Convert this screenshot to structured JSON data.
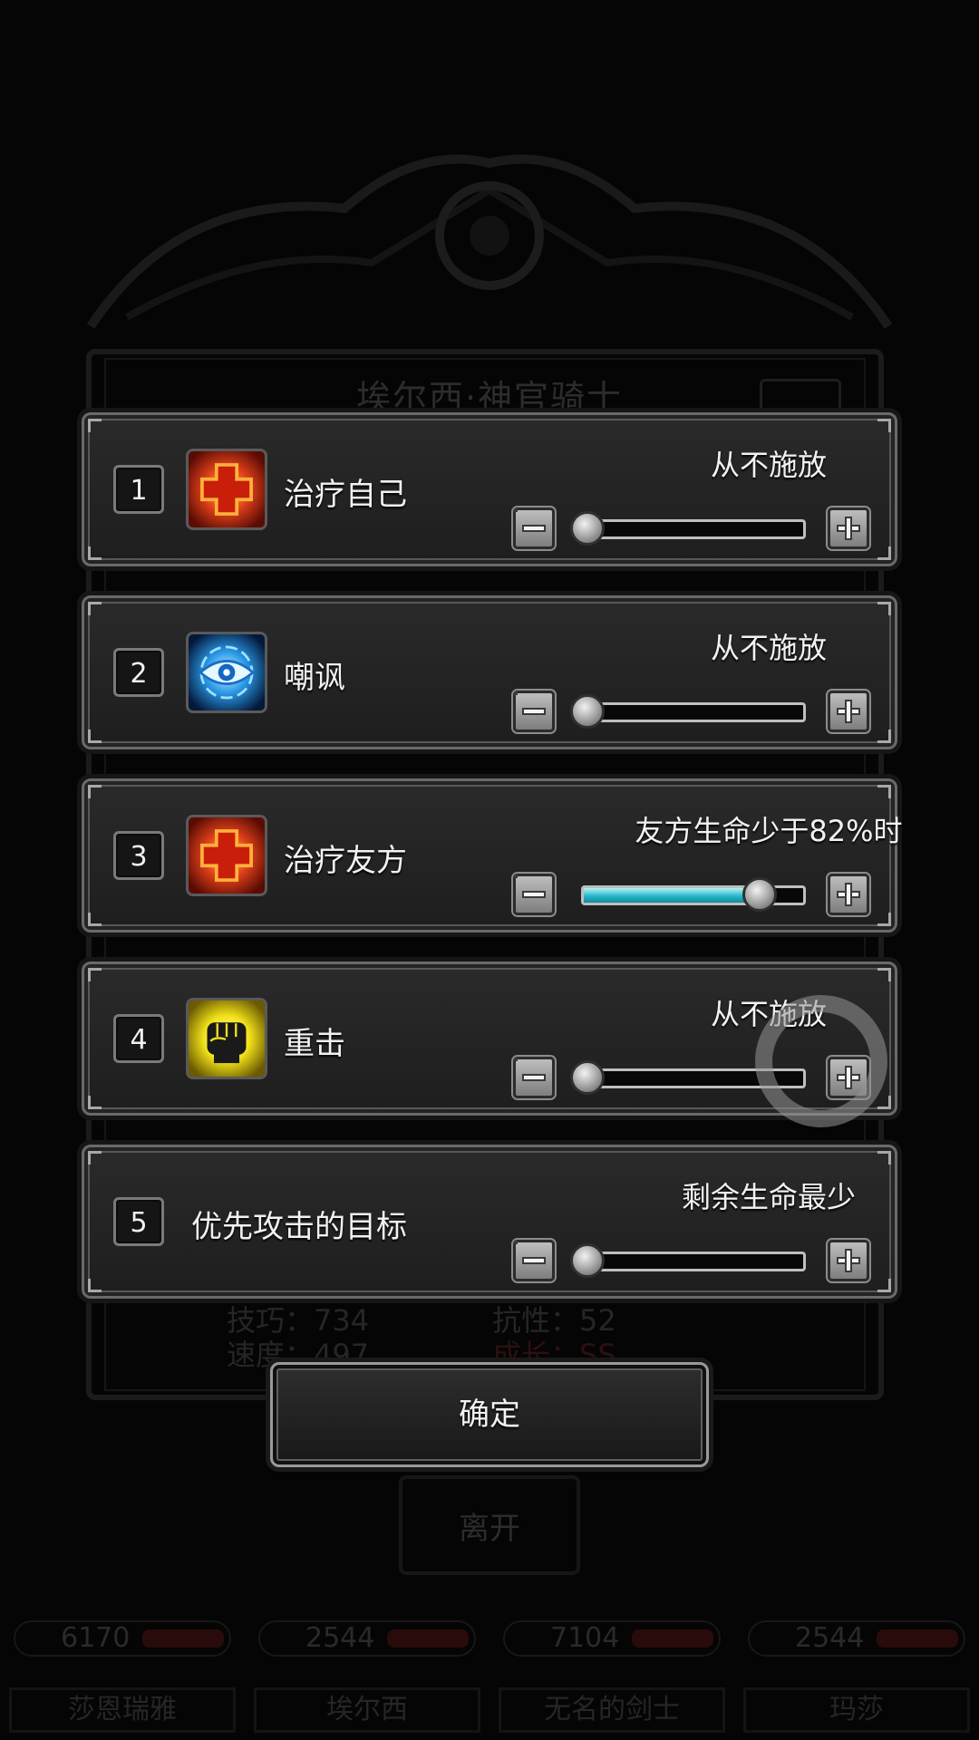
{
  "background": {
    "hero_title": "埃尔西·神官骑士",
    "stats": [
      {
        "label": "技巧：734"
      },
      {
        "label": "抗性：52"
      },
      {
        "label": "速度：497"
      },
      {
        "label": "成长：SS"
      }
    ],
    "leave_button": "离开",
    "party": [
      {
        "hp": "6170",
        "name": "莎恩瑞雅"
      },
      {
        "hp": "2544",
        "name": "埃尔西"
      },
      {
        "hp": "7104",
        "name": "无名的剑士"
      },
      {
        "hp": "2544",
        "name": "玛莎"
      }
    ]
  },
  "skills": [
    {
      "number": "1",
      "name": "治疗自己",
      "icon": "heal-cross-icon",
      "status": "从不施放",
      "slider_value": 0.0
    },
    {
      "number": "2",
      "name": "嘲讽",
      "icon": "taunt-eye-icon",
      "status": "从不施放",
      "slider_value": 0.0
    },
    {
      "number": "3",
      "name": "治疗友方",
      "icon": "heal-cross-icon",
      "status": "友方生命少于82%时",
      "slider_value": 0.82
    },
    {
      "number": "4",
      "name": "重击",
      "icon": "fist-strike-icon",
      "status": "从不施放",
      "slider_value": 0.0
    },
    {
      "number": "5",
      "name": "优先攻击的目标",
      "icon": "",
      "status": "剩余生命最少",
      "slider_value": 0.0
    }
  ],
  "confirm_button": "确定",
  "colors": {
    "slider_fill": "#27b7c8",
    "heal_icon": "#e0401a",
    "taunt_icon": "#2a9ae8",
    "strike_icon": "#f2e21a"
  }
}
